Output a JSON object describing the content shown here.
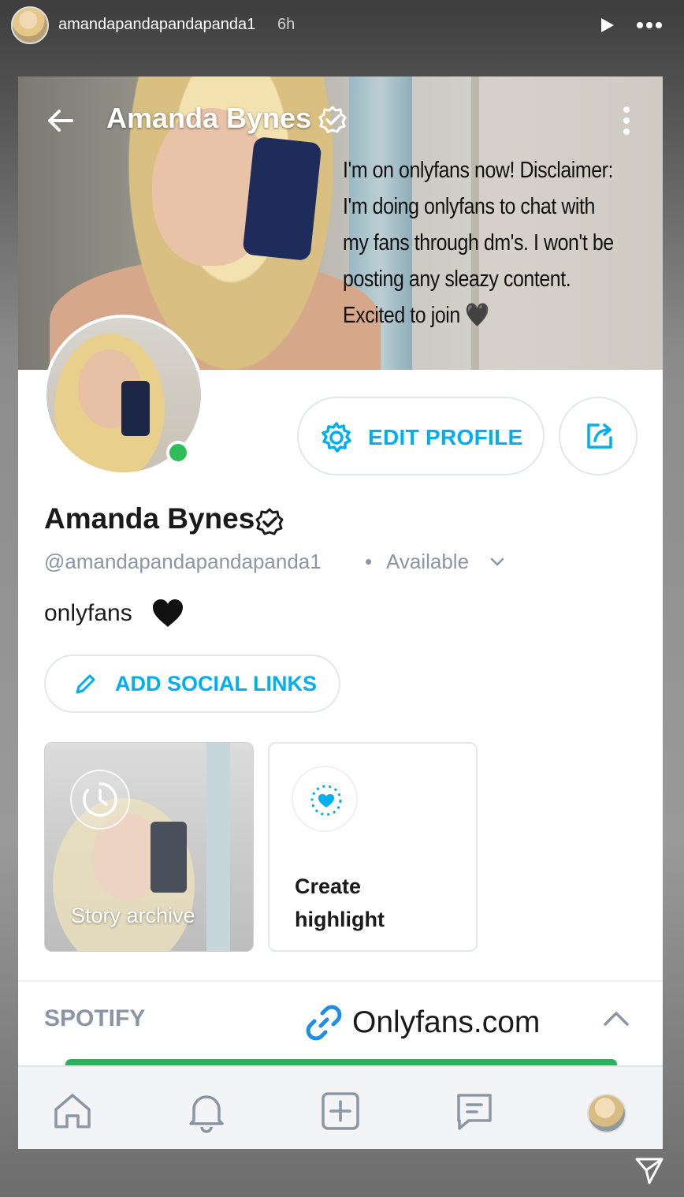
{
  "story": {
    "username": "amandapandapandapanda1",
    "time_ago": "6h"
  },
  "header": {
    "title": "Amanda Bynes"
  },
  "caption": {
    "text": "I'm on onlyfans now! Disclaimer: I'm doing onlyfans to chat with my fans through dm's. I won't be posting any sleazy content. Excited to join 🖤"
  },
  "profile": {
    "name": "Amanda Bynes",
    "handle": "@amandapandapandapanda1",
    "separator": "•",
    "status": "Available",
    "bio": "onlyfans",
    "online_color": "#2ebd59"
  },
  "buttons": {
    "edit_profile": "EDIT PROFILE",
    "add_social_links": "ADD SOCIAL LINKS"
  },
  "tiles": {
    "story_archive": "Story archive",
    "create_highlight": "Create highlight"
  },
  "sections": {
    "spotify": "SPOTIFY"
  },
  "link_sticker": {
    "text": "Onlyfans.com"
  },
  "theme": {
    "accent": "#00aff0",
    "muted": "#8a96a3"
  },
  "icons": {
    "story_header": [
      "play-icon",
      "more-icon"
    ],
    "profile_header": [
      "back-arrow-icon",
      "verified-badge-icon",
      "kebab-menu-icon"
    ],
    "tabbar": [
      "home-icon",
      "bell-icon",
      "add-post-icon",
      "messages-icon",
      "profile-avatar"
    ],
    "footer": [
      "send-icon"
    ]
  }
}
